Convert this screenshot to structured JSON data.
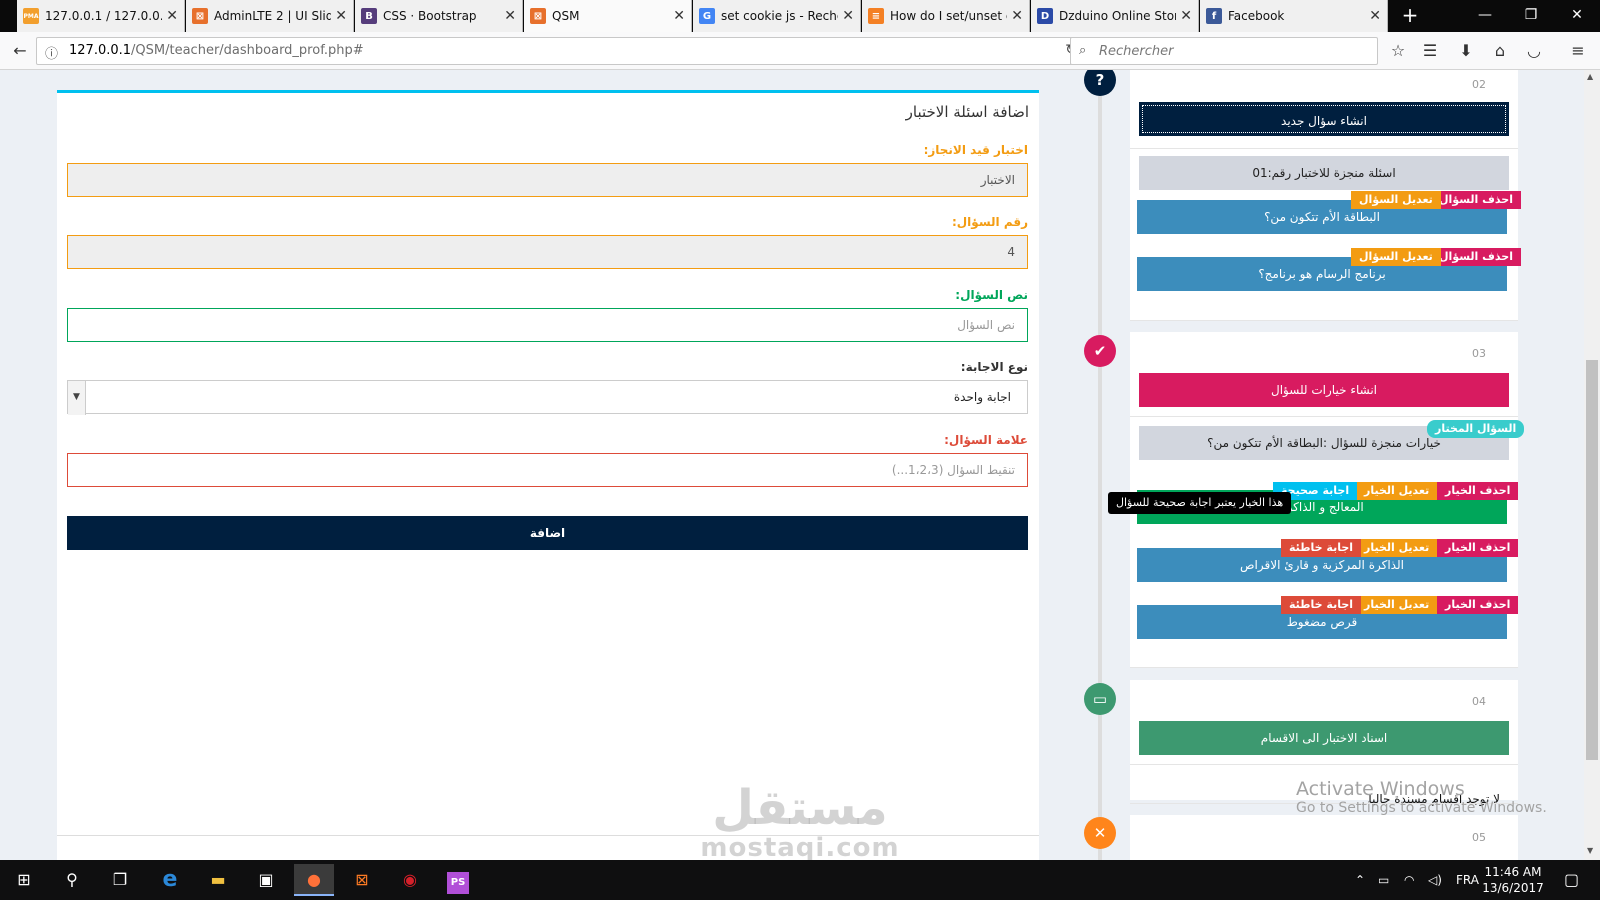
{
  "browser": {
    "tabs": [
      {
        "label": "127.0.0.1 / 127.0.0.1 /",
        "icon": "phpmyadmin-icon",
        "fav_text": "PMA",
        "fav_color": "#f29f2d"
      },
      {
        "label": "AdminLTE 2 | UI Slide",
        "icon": "xampp-icon",
        "fav_text": "⊠",
        "fav_color": "#e7702c"
      },
      {
        "label": "CSS · Bootstrap",
        "icon": "bootstrap-icon",
        "fav_text": "B",
        "fav_color": "#563d7c"
      },
      {
        "label": "QSM",
        "icon": "xampp-icon",
        "fav_text": "⊠",
        "fav_color": "#e7702c"
      },
      {
        "label": "set cookie js - Recher",
        "icon": "google-icon",
        "fav_text": "G",
        "fav_color": "#4285f4"
      },
      {
        "label": "How do I set/unset c",
        "icon": "stackoverflow-icon",
        "fav_text": "≡",
        "fav_color": "#f48024"
      },
      {
        "label": "Dzduino Online Store",
        "icon": "dzduino-icon",
        "fav_text": "D",
        "fav_color": "#2b4aa7"
      },
      {
        "label": "Facebook",
        "icon": "facebook-icon",
        "fav_text": "f",
        "fav_color": "#3b5998"
      }
    ],
    "url_host": "127.0.0.1",
    "url_path": "/QSM/teacher/dashboard_prof.php#",
    "search_placeholder": "Rechercher"
  },
  "form": {
    "title": "اضافة اسئلة الاختبار",
    "exam_label": "اختبار قيد الانجاز:",
    "exam_value": "الاختبار",
    "qnum_label": "رقم السؤال:",
    "qnum_value": "4",
    "qtext_label": "نص السؤال:",
    "qtext_placeholder": "نص السؤال",
    "atype_label": "نوع الاجابة:",
    "atype_selected": "اجابة واحدة",
    "score_label": "علامة السؤال:",
    "score_placeholder": "تنقيط السؤال (1،2،3...)",
    "submit_label": "اضافة"
  },
  "timeline": {
    "step2": {
      "time": "02",
      "create_btn": "انشاء سؤال جديد",
      "header": "اسئلة منجزة للاختبار رقم:01",
      "questions": [
        {
          "text": "البطاقة الأم تتكون من؟",
          "delete": "احذف السؤال",
          "edit": "تعديل السؤال"
        },
        {
          "text": "برنامج الرسام هو برنامج؟",
          "delete": "احذف السؤال",
          "edit": "تعديل السؤال"
        }
      ]
    },
    "step3": {
      "time": "03",
      "create_btn": "انشاء خيارات للسؤال",
      "selected_badge": "السؤال المختار",
      "header": "خيارات منجزة للسؤال :البطاقة الأم تتكون من؟",
      "tooltip": "هذا الخيار يعتبر اجابة صحيحة للسؤال",
      "choices": [
        {
          "text": "المعالج و الذاكرة",
          "delete": "احذف الخيار",
          "edit": "تعديل الخيار",
          "status": "اجابة صحيحة"
        },
        {
          "text": "الذاكرة المركزية و قارئ الاقراص",
          "delete": "احذف الخيار",
          "edit": "تعديل الخيار",
          "status": "اجابة خاطئة"
        },
        {
          "text": "قرص مضغوط",
          "delete": "احذف الخيار",
          "edit": "تعديل الخيار",
          "status": "اجابة خاطئة"
        }
      ]
    },
    "step4": {
      "time": "04",
      "assign_btn": "اسناد الاختبار الى الاقسام",
      "empty_text": "لا توجد اقسام مسندة حاليا"
    },
    "step5": {
      "time": "05"
    },
    "icons": {
      "step2": "?",
      "step3": "✔",
      "step4": "▭",
      "step5": "✕"
    },
    "colors": {
      "step2": "#001f3f",
      "step3": "#d81b60",
      "step4": "#3d9970",
      "step5": "#ff851b"
    }
  },
  "overlay": {
    "activate_title": "Activate Windows",
    "activate_sub": "Go to Settings to activate Windows.",
    "watermark_ar": "مستقل",
    "watermark_en": "mostaqi.com"
  },
  "taskbar": {
    "lang": "FRA",
    "time": "11:46 AM",
    "date": "13/6/2017"
  }
}
